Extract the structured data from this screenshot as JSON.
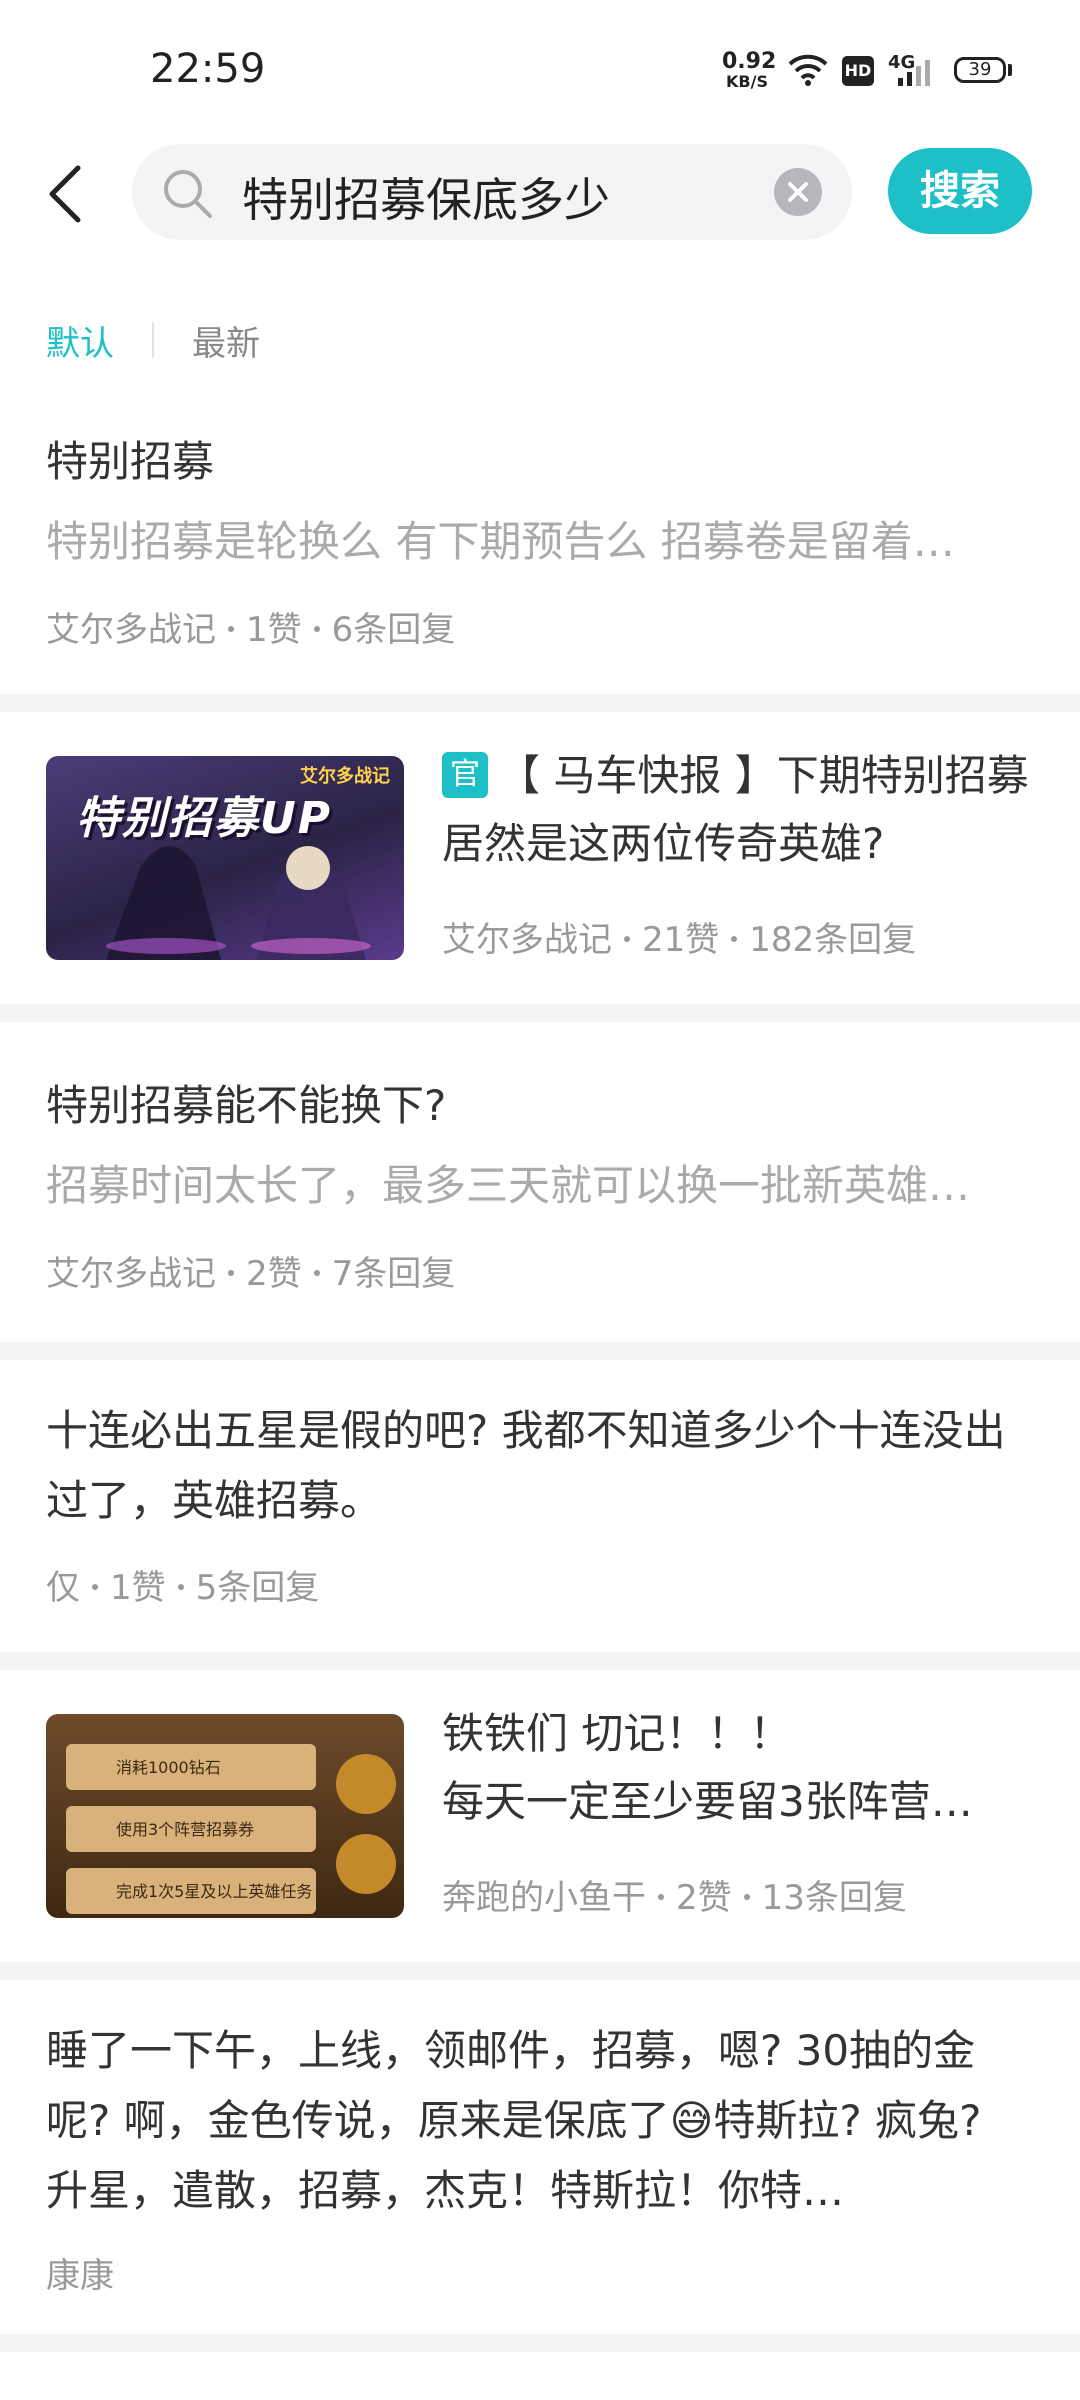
{
  "status_bar": {
    "time": "22:59",
    "net_speed_value": "0.92",
    "net_speed_unit": "KB/S",
    "hd_label": "HD",
    "signal_label": "4G",
    "battery": "39",
    "icons": [
      "wifi-icon",
      "hd-icon",
      "signal-icon",
      "battery-icon"
    ]
  },
  "search": {
    "query": "特别招募保底多少",
    "button_label": "搜索",
    "icons": [
      "back-arrow-icon",
      "search-icon",
      "clear-icon"
    ]
  },
  "sort_tabs": [
    {
      "label": "默认",
      "active": true
    },
    {
      "label": "最新",
      "active": false
    }
  ],
  "colors": {
    "accent": "#1ec0c8",
    "divider": "#f2f3f5",
    "muted": "#999999"
  },
  "posts": [
    {
      "title": "特别招募",
      "snippet": "特别招募是轮换么 有下期预告么 招募卷是留着…",
      "author": "艾尔多战记",
      "likes": "1赞",
      "replies": "6条回复"
    },
    {
      "official_badge": "官",
      "title": "【 马车快报 】下期特别招募居然是这两位传奇英雄?",
      "author": "艾尔多战记",
      "likes": "21赞",
      "replies": "182条回复",
      "thumbnail_text": "特别招募UP",
      "thumbnail_logo": "艾尔多战记"
    },
    {
      "title": "特别招募能不能换下?",
      "snippet": "招募时间太长了，最多三天就可以换一批新英雄…",
      "author": "艾尔多战记",
      "likes": "2赞",
      "replies": "7条回复"
    },
    {
      "body": "十连必出五星是假的吧? 我都不知道多少个十连没出过了，英雄招募。",
      "author": "仅",
      "likes": "1赞",
      "replies": "5条回复"
    },
    {
      "title": "铁铁们 切记！！！",
      "snippet": "每天一定至少要留3张阵营…",
      "author": "奔跑的小鱼干",
      "likes": "2赞",
      "replies": "13条回复",
      "thumbnail_rows": [
        "消耗1000钻石",
        "使用3个阵营招募券",
        "完成1次5星及以上英雄任务"
      ]
    },
    {
      "body": "睡了一下午，上线，领邮件，招募，嗯? 30抽的金呢? 啊，金色传说，原来是保底了😅特斯拉? 疯兔? 升星，遣散，招募，杰克！特斯拉！你特…",
      "author": "康康"
    }
  ]
}
